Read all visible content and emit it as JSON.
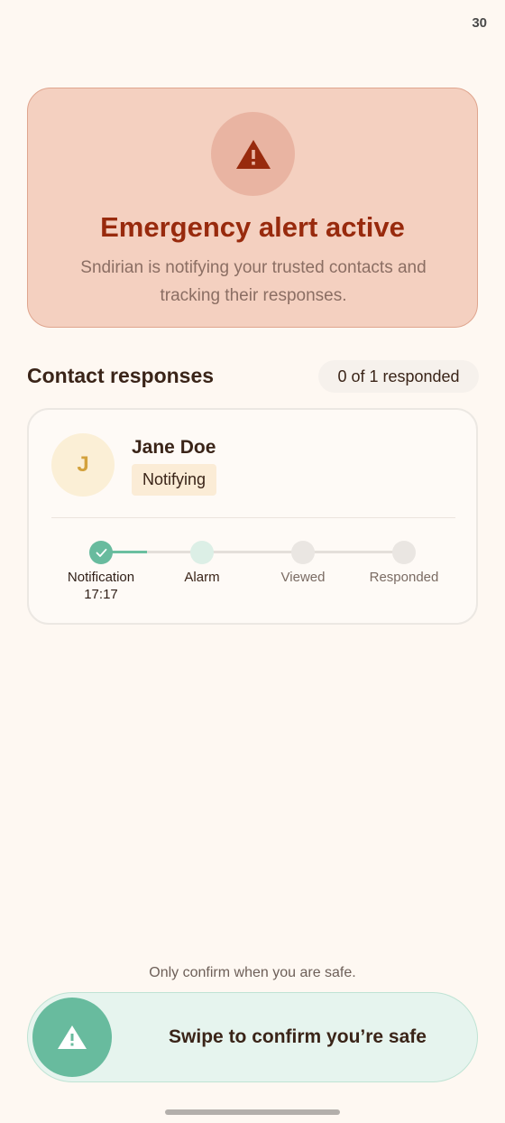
{
  "status_bar": {
    "battery": "30"
  },
  "alert": {
    "icon": "warning-icon",
    "title": "Emergency alert active",
    "description": "Sndirian is notifying your trusted contacts and tracking their responses."
  },
  "contacts_section": {
    "title": "Contact responses",
    "response_count": "0 of 1 responded"
  },
  "contact": {
    "initial": "J",
    "name": "Jane Doe",
    "status": "Notifying",
    "steps": [
      {
        "label": "Notification",
        "time": "17:17",
        "state": "done"
      },
      {
        "label": "Alarm",
        "time": "",
        "state": "active"
      },
      {
        "label": "Viewed",
        "time": "",
        "state": "pending"
      },
      {
        "label": "Responded",
        "time": "",
        "state": "pending"
      }
    ]
  },
  "safety_note": "Only confirm when you are safe.",
  "swipe": {
    "label": "Swipe to confirm you’re safe",
    "icon": "warning-icon"
  },
  "colors": {
    "background": "#fef8f2",
    "alert_bg": "#f4d0c0",
    "alert_title": "#982a0d",
    "accent_green": "#68bb9e",
    "avatar_bg": "#fbefd6"
  }
}
